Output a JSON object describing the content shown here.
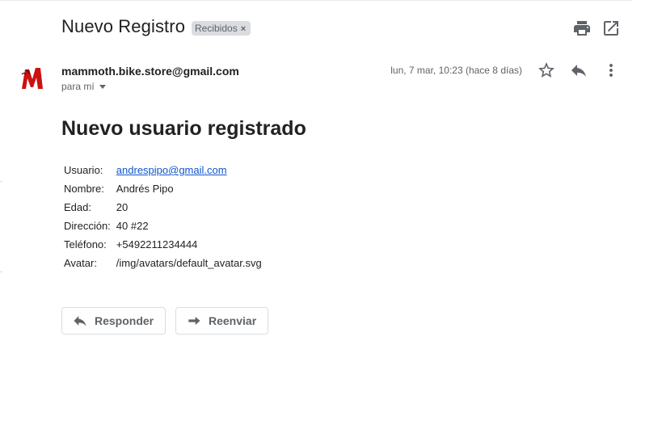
{
  "email": {
    "subject": "Nuevo Registro",
    "label_chip": "Recibidos",
    "label_close": "×",
    "sender": "mammoth.bike.store@gmail.com",
    "to_label": "para mí",
    "date": "lun, 7 mar, 10:23 (hace 8 días)"
  },
  "body": {
    "heading": "Nuevo usuario registrado",
    "rows": [
      {
        "key": "Usuario:",
        "value": "andrespipo@gmail.com"
      },
      {
        "key": "Nombre:",
        "value": "Andrés Pipo"
      },
      {
        "key": "Edad:",
        "value": "20"
      },
      {
        "key": "Dirección:",
        "value": "40 #22"
      },
      {
        "key": "Teléfono:",
        "value": "+5492211234444"
      },
      {
        "key": "Avatar:",
        "value": "/img/avatars/default_avatar.svg"
      }
    ]
  },
  "actions": {
    "reply_label": "Responder",
    "forward_label": "Reenviar"
  },
  "icons": {
    "print": "print-icon",
    "open_new_window": "open-in-new-icon",
    "star": "star-outline-icon",
    "reply": "reply-icon",
    "more": "more-vertical-icon",
    "sender_logo": "mammoth-m-logo"
  },
  "colors": {
    "link": "#1155cc",
    "logo_red": "#cc1111",
    "chip_bg": "#dadce0",
    "icon_gray": "#5f6368"
  }
}
